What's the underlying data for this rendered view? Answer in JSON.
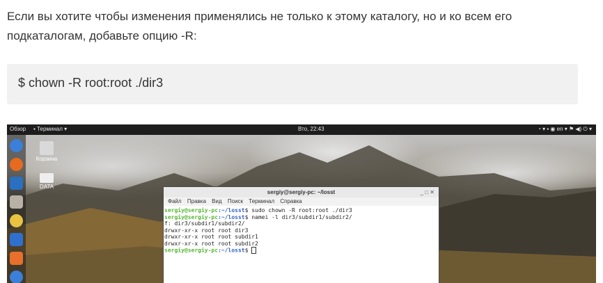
{
  "article": {
    "paragraph": "Если вы хотите чтобы изменения применялись не только к этому каталогу, но и ко всем его подкаталогам, добавьте опцию -R:",
    "code": "$ chown -R root:root ./dir3"
  },
  "desktop": {
    "topbar": {
      "activities": "Обзор",
      "app_menu": "▪ Терминал ▾",
      "clock": "Вто, 22:43",
      "tray": "◔ ▾  ▪  ◉  en ▾  ⚑ ◀) ⏻ ▾"
    },
    "dock_icons": [
      "chromium-icon",
      "firefox-icon",
      "thunderbird-icon",
      "files-icon",
      "rhythmbox-icon",
      "writer-icon",
      "software-center-icon",
      "help-icon"
    ],
    "desktop_icons": [
      {
        "label": "Корзина",
        "icon": "trash-icon"
      },
      {
        "label": "DATA",
        "icon": "drive-icon"
      }
    ],
    "terminal": {
      "title": "sergiy@sergiy-pc: ~/losst",
      "controls": "_   □   ✕",
      "menu": [
        "Файл",
        "Правка",
        "Вид",
        "Поиск",
        "Терминал",
        "Справка"
      ],
      "prompt_user": "sergiy@sergiy-pc",
      "prompt_path": ":~/losst",
      "prompt_symbol": "$ ",
      "cmd1": "sudo chown -R root:root ./dir3",
      "cmd2": "namei -l dir3/subdir1/subdir2/",
      "out1": "f: dir3/subdir1/subdir2/",
      "out2": "drwxr-xr-x root root dir3",
      "out3": "drwxr-xr-x root root subdir1",
      "out4": "drwxr-xr-x root root subdir2"
    }
  },
  "colors": {
    "prompt_user": "#55b832",
    "prompt_path": "#2f62c6",
    "code_bg": "#f1f1f1",
    "text": "#333333"
  }
}
